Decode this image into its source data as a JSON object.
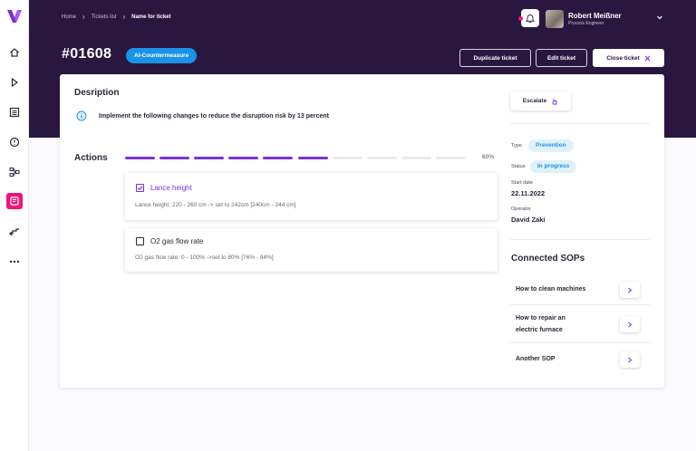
{
  "breadcrumb": {
    "home": "Home",
    "tickets_list": "Tickets list",
    "current": "Name for ticket"
  },
  "user": {
    "name": "Robert Meißner",
    "role": "Process Engineer"
  },
  "ticket": {
    "id": "#01608",
    "tag": "AI-Countermeasure"
  },
  "header_buttons": {
    "duplicate": "Duplicate ticket",
    "edit": "Edit ticket",
    "close": "Close ticket"
  },
  "description": {
    "title": "Desription",
    "text": "Implement the following changes to reduce the disruption risk by 13 percent"
  },
  "actions": {
    "title": "Actions",
    "progress_label": "60%",
    "progress_fraction": 0.6,
    "segments_total": 10,
    "segments_done": 6,
    "items": [
      {
        "title": "Lance height",
        "checked": true,
        "detail": "Lance height: 220 - 260 cm -> set to 242cm [240cm - 244 cm]"
      },
      {
        "title": "O2 gas flow rate",
        "checked": false,
        "detail": "O2 gas flow rate: 0 - 100% ->set to 80% [76% - 84%]"
      }
    ]
  },
  "escalate": {
    "label": "Escalate"
  },
  "meta": {
    "type_label": "Type",
    "type_value": "Prevention",
    "status_label": "Status",
    "status_value": "In progress",
    "start_label": "Start date",
    "start_value": "22.11.2022",
    "operator_label": "Operator",
    "operator_value": "David Zaki"
  },
  "sops": {
    "title": "Connected SOPs",
    "items": [
      {
        "line1": "How to clean machines",
        "line2": ""
      },
      {
        "line1": "How to repair an",
        "line2": "electric furnace"
      },
      {
        "line1": "Another SOP",
        "line2": ""
      }
    ]
  },
  "colors": {
    "brand_dark": "#29173f",
    "accent_purple": "#7a32d9",
    "accent_pink": "#f0147a",
    "accent_blue": "#1a93e6",
    "pill_bg": "#dff2f8"
  },
  "icons": {
    "logo": "brand-logo-icon",
    "nav": [
      "home-icon",
      "play-icon",
      "list-icon",
      "alert-icon",
      "flow-icon",
      "ticket-icon",
      "steps-icon",
      "more-icon"
    ],
    "header": [
      "bell-icon",
      "chevron-down-icon",
      "close-icon"
    ],
    "content": [
      "info-icon",
      "escalate-hand-icon",
      "chevron-right-icon"
    ]
  }
}
